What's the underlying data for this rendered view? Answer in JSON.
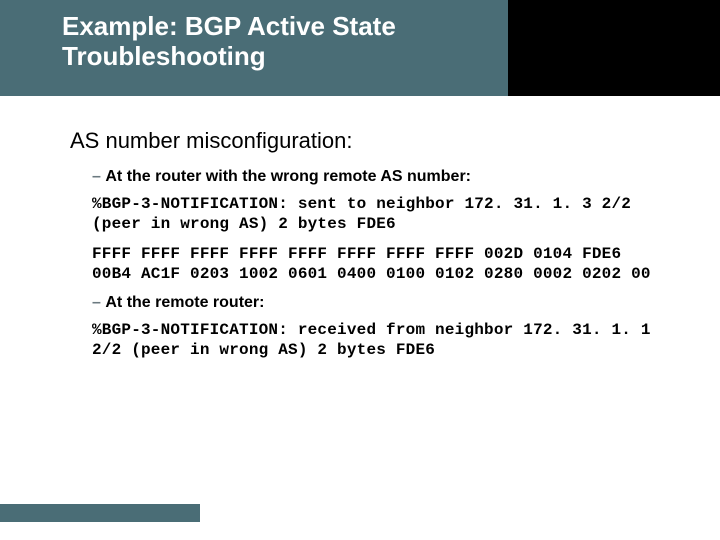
{
  "header": {
    "title": "Example: BGP Active State Troubleshooting"
  },
  "section": {
    "title": "AS number misconfiguration:"
  },
  "items": {
    "bullet1": "At the router with the wrong remote AS number:",
    "mono1": "%BGP-3-NOTIFICATION: sent to neighbor 172. 31. 1. 3 2/2 (peer in wrong AS) 2 bytes FDE6",
    "mono2": "FFFF FFFF FFFF FFFF FFFF FFFF FFFF FFFF 002D 0104 FDE6 00B4 AC1F 0203 1002 0601 0400 0100 0102 0280 0002 0202 00",
    "bullet2": "At the remote router:",
    "mono3": "%BGP-3-NOTIFICATION: received from neighbor 172. 31. 1. 1 2/2 (peer in wrong AS) 2 bytes FDE6"
  },
  "glyph": {
    "dash": "–"
  }
}
